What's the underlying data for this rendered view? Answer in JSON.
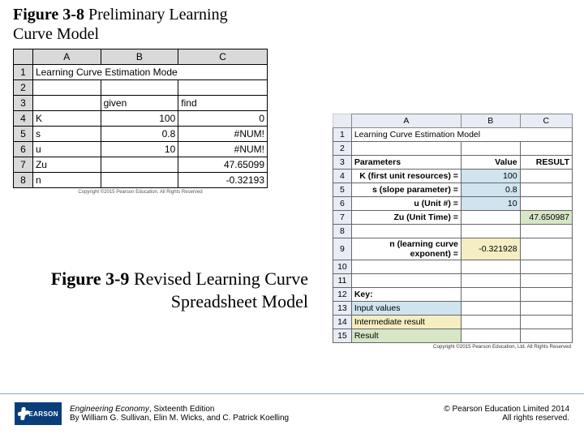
{
  "titles": {
    "fig38": {
      "label": "Figure 3-8",
      "rest": " Preliminary Learning Curve Model"
    },
    "fig39": {
      "label": "Figure 3-9",
      "rest": " Revised Learning Curve Spreadsheet Model"
    }
  },
  "fig38": {
    "cols": [
      "A",
      "B",
      "C"
    ],
    "rownums": [
      "1",
      "2",
      "3",
      "4",
      "5",
      "6",
      "7",
      "8"
    ],
    "row1": "Learning Curve Estimation Mode",
    "row3": {
      "B": "given",
      "C": "find"
    },
    "rows": [
      {
        "A": "K",
        "B": "100",
        "C": "0"
      },
      {
        "A": "s",
        "B": "0.8",
        "C": "#NUM!"
      },
      {
        "A": "u",
        "B": "10",
        "C": "#NUM!"
      },
      {
        "A": "Zu",
        "B": "",
        "C": "47.65099"
      },
      {
        "A": "n",
        "B": "",
        "C": "-0.32193"
      }
    ],
    "copyright": "Copyright ©2015 Pearson Education. All Rights Reserved"
  },
  "fig39": {
    "cols": [
      "A",
      "B",
      "C"
    ],
    "rownums": [
      "1",
      "2",
      "3",
      "4",
      "5",
      "6",
      "7",
      "8",
      "9",
      "10",
      "11",
      "12",
      "13",
      "14",
      "15"
    ],
    "row1": "Learning Curve Estimation Model",
    "header": {
      "A": "Parameters",
      "B": "Value",
      "C": "RESULT"
    },
    "params": {
      "K": {
        "label": "K (first unit resources) =",
        "value": "100"
      },
      "s": {
        "label": "s (slope parameter) =",
        "value": "0.8"
      },
      "u": {
        "label": "u (Unit #) =",
        "value": "10"
      },
      "Zu": {
        "label": "Zu (Unit Time) =",
        "value": "",
        "result": "47.650987"
      },
      "n": {
        "label": "n (learning curve exponent) =",
        "value": "-0.321928"
      }
    },
    "key": {
      "heading": "Key:",
      "input": "Input values",
      "intermediate": "Intermediate result",
      "result": "Result"
    },
    "copyright": "Copyright ©2015 Pearson Education, Ltd. All Rights Reserved"
  },
  "footer": {
    "brand": "PEARSON",
    "book_title": "Engineering Economy",
    "book_edition": ", Sixteenth Edition",
    "authors": "By William G. Sullivan, Elin M. Wicks, and C. Patrick Koelling",
    "copyright_line": "© Pearson Education Limited 2014",
    "rights": "All rights reserved."
  }
}
